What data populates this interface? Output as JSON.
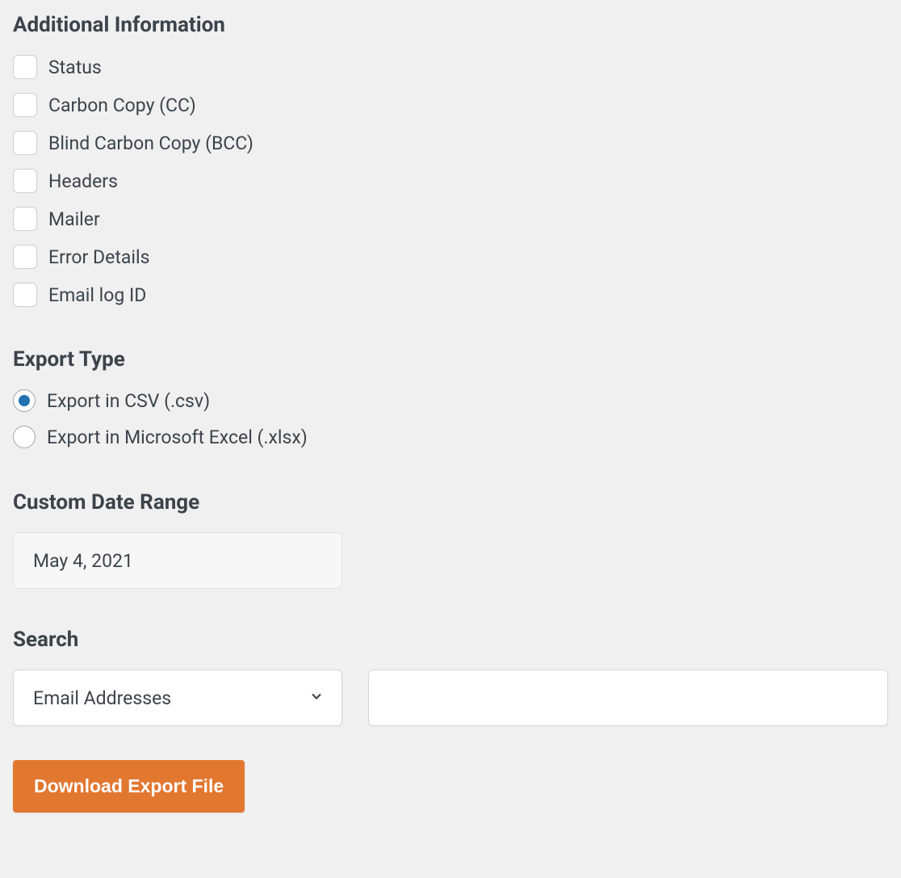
{
  "additional_info": {
    "heading": "Additional Information",
    "items": [
      {
        "label": "Status",
        "checked": false
      },
      {
        "label": "Carbon Copy (CC)",
        "checked": false
      },
      {
        "label": "Blind Carbon Copy (BCC)",
        "checked": false
      },
      {
        "label": "Headers",
        "checked": false
      },
      {
        "label": "Mailer",
        "checked": false
      },
      {
        "label": "Error Details",
        "checked": false
      },
      {
        "label": "Email log ID",
        "checked": false
      }
    ]
  },
  "export_type": {
    "heading": "Export Type",
    "options": [
      {
        "label": "Export in CSV (.csv)",
        "selected": true
      },
      {
        "label": "Export in Microsoft Excel (.xlsx)",
        "selected": false
      }
    ]
  },
  "date_range": {
    "heading": "Custom Date Range",
    "value": "May 4, 2021"
  },
  "search": {
    "heading": "Search",
    "select_value": "Email Addresses",
    "input_value": ""
  },
  "download_button": "Download Export File"
}
